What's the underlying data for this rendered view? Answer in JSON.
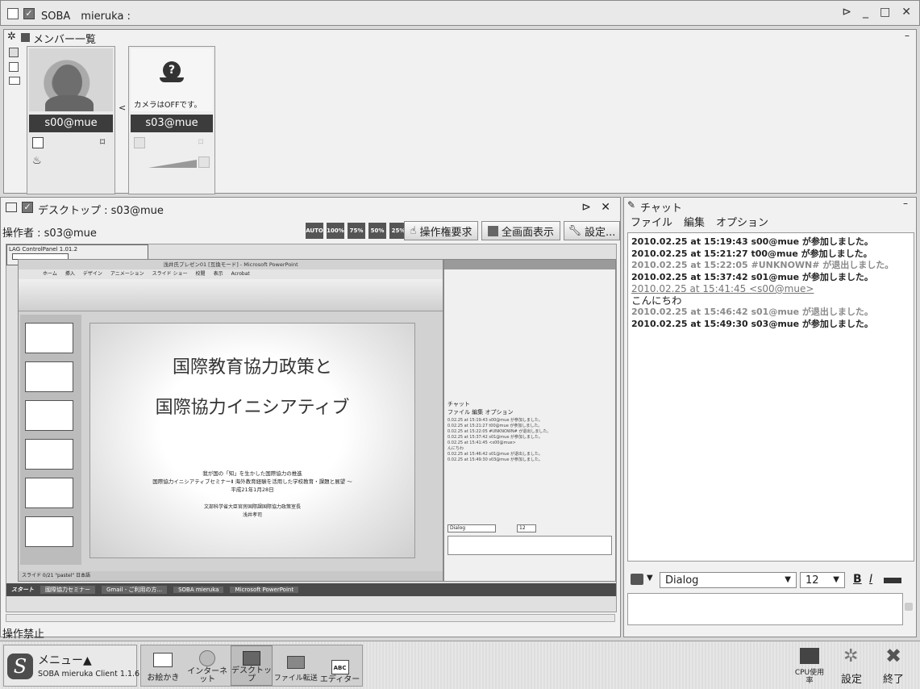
{
  "window": {
    "title": "SOBA　mieruka :",
    "controls": [
      "⊳",
      "_",
      "□",
      "✕"
    ]
  },
  "members": {
    "title": "メンバー一覧",
    "cards": [
      {
        "name": "s00@mue"
      },
      {
        "name": "s03@mue",
        "camera_status": "カメラはOFFです。"
      }
    ],
    "arrow": "<"
  },
  "desktop": {
    "title": "デスクトップ : s03@mue",
    "operator": "操作者 : s03@mue",
    "zoom_buttons": [
      "AUTO",
      "100%",
      "75%",
      "50%",
      "25%"
    ],
    "request_button": "操作権要求",
    "fullscreen_button": "全画面表示",
    "settings_button": "設定...",
    "status": "操作禁止",
    "slide_title_1": "国際教育協力政策と",
    "slide_title_2": "国際協力イニシアティブ",
    "slide_sub_1": "我が国の「知」を生かした国際協力の推進",
    "slide_sub_2": "国際協力イニシアティブセミナーⅡ 海外教育経験を活用した学校教育・課題と展望 ～",
    "slide_sub_3": "平成21年1月28日",
    "slide_sub_4": "文部科学省大臣官房国際課国際協力政策室長",
    "slide_sub_5": "浅井孝司",
    "ppt_title": "浅井氏プレゼン01 [互換モード] - Microsoft PowerPoint",
    "ppt_tabs": [
      "ホーム",
      "挿入",
      "デザイン",
      "アニメーション",
      "スライド ショー",
      "校閲",
      "表示",
      "Acrobat"
    ],
    "lag_panel": "LAG ControlPanel 1.01.2",
    "mini_chat_header": "チャット",
    "mini_chat_menu": "ファイル 編集 オプション",
    "taskbar_start": "スタート",
    "taskbar_items": [
      "國際協力セミナー",
      "Gmail - ご利用の方...",
      "SOBA mieruka",
      "Microsoft PowerPoint"
    ],
    "ppt_status": "スライド 0/21  \"pastel\"  日本語",
    "mini_font": "Dialog",
    "mini_size": "12"
  },
  "chat": {
    "title": "チャット",
    "menu": [
      "ファイル",
      "編集",
      "オプション"
    ],
    "lines": [
      {
        "text": "2010.02.25 at 15:19:43 s00@mue が参加しました。",
        "style": "bold"
      },
      {
        "text": "2010.02.25 at 15:21:27 t00@mue が参加しました。",
        "style": "bold"
      },
      {
        "text": "2010.02.25 at 15:22:05 #UNKNOWN# が退出しました。",
        "style": "gray"
      },
      {
        "text": "2010.02.25 at 15:37:42 s01@mue が参加しました。",
        "style": "bold"
      },
      {
        "text": "2010.02.25 at 15:41:45 <s00@mue>",
        "style": "link"
      },
      {
        "text": "こんにちわ",
        "style": "normal"
      },
      {
        "text": "2010.02.25 at 15:46:42 s01@mue が退出しました。",
        "style": "gray"
      },
      {
        "text": "2010.02.25 at 15:49:30 s03@mue が参加しました。",
        "style": "bold"
      }
    ],
    "font": "Dialog",
    "size": "12",
    "bold_label": "B",
    "italic_label": "I"
  },
  "taskbar": {
    "menu_label": "メニュー▲",
    "client_version": "SOBA mieruka Client 1.1.6",
    "tools": [
      {
        "label": "お絵かき"
      },
      {
        "label": "インターネット"
      },
      {
        "label": "デスクトップ"
      },
      {
        "label": "ファイル転送"
      },
      {
        "label": "エディター"
      }
    ],
    "right": [
      {
        "label": "CPU使用率"
      },
      {
        "label": "設定"
      },
      {
        "label": "終了"
      }
    ]
  }
}
